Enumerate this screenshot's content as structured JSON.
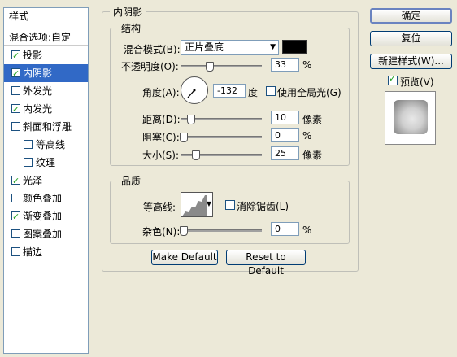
{
  "styles_panel": {
    "header": "样式",
    "blend_options": "混合选项:自定",
    "items": [
      {
        "label": "投影",
        "checked": true,
        "selected": false,
        "indent": false
      },
      {
        "label": "内阴影",
        "checked": true,
        "selected": true,
        "indent": false
      },
      {
        "label": "外发光",
        "checked": false,
        "selected": false,
        "indent": false
      },
      {
        "label": "内发光",
        "checked": true,
        "selected": false,
        "indent": false
      },
      {
        "label": "斜面和浮雕",
        "checked": false,
        "selected": false,
        "indent": false
      },
      {
        "label": "等高线",
        "checked": false,
        "selected": false,
        "indent": true
      },
      {
        "label": "纹理",
        "checked": false,
        "selected": false,
        "indent": true
      },
      {
        "label": "光泽",
        "checked": true,
        "selected": false,
        "indent": false
      },
      {
        "label": "颜色叠加",
        "checked": false,
        "selected": false,
        "indent": false
      },
      {
        "label": "渐变叠加",
        "checked": true,
        "selected": false,
        "indent": false
      },
      {
        "label": "图案叠加",
        "checked": false,
        "selected": false,
        "indent": false
      },
      {
        "label": "描边",
        "checked": false,
        "selected": false,
        "indent": false
      }
    ]
  },
  "inner_shadow": {
    "title": "内阴影",
    "structure": {
      "title": "结构",
      "blend_mode_label": "混合模式(B):",
      "blend_mode_value": "正片叠底",
      "color": "#000000",
      "opacity_label": "不透明度(O):",
      "opacity_value": "33",
      "opacity_unit": "%",
      "angle_label": "角度(A):",
      "angle_value": "-132",
      "angle_unit": "度",
      "global_light_label": "使用全局光(G)",
      "distance_label": "距离(D):",
      "distance_value": "10",
      "distance_unit": "像素",
      "choke_label": "阻塞(C):",
      "choke_value": "0",
      "choke_unit": "%",
      "size_label": "大小(S):",
      "size_value": "25",
      "size_unit": "像素"
    },
    "quality": {
      "title": "品质",
      "contour_label": "等高线:",
      "anti_alias_label": "消除锯齿(L)",
      "noise_label": "杂色(N):",
      "noise_value": "0",
      "noise_unit": "%"
    },
    "make_default": "Make Default",
    "reset_default": "Reset to Default"
  },
  "right": {
    "ok": "确定",
    "reset": "复位",
    "new_style": "新建样式(W)...",
    "preview_label": "预览(V)",
    "preview_checked": true
  }
}
